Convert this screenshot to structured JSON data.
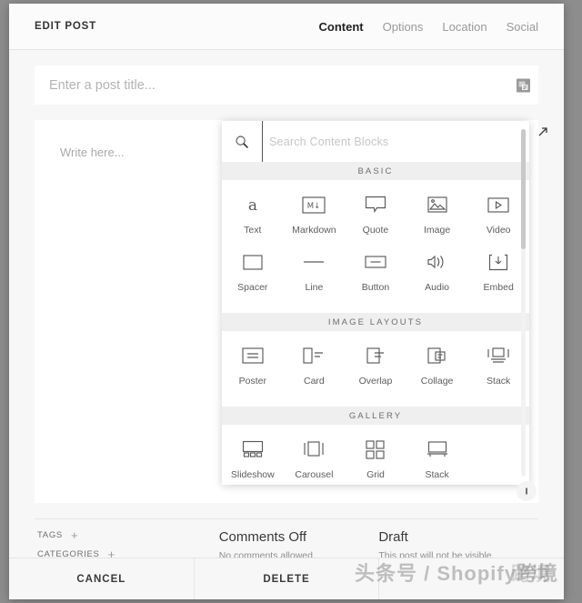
{
  "header": {
    "title": "EDIT POST",
    "tabs": [
      {
        "label": "Content",
        "active": true
      },
      {
        "label": "Options",
        "active": false
      },
      {
        "label": "Location",
        "active": false
      },
      {
        "label": "Social",
        "active": false
      }
    ]
  },
  "title_input": {
    "placeholder": "Enter a post title...",
    "value": "",
    "icon": "ime-keyboard-icon"
  },
  "editor": {
    "placeholder": "Write here...",
    "expand_icon": "expand-arrow-icon",
    "resize_icon": "resize-handle-icon"
  },
  "picker": {
    "search": {
      "placeholder": "Search Content Blocks",
      "value": "",
      "icon": "search-icon"
    },
    "sections": [
      {
        "name": "BASIC",
        "items": [
          {
            "label": "Text",
            "icon": "letter-a-icon"
          },
          {
            "label": "Markdown",
            "icon": "markdown-icon"
          },
          {
            "label": "Quote",
            "icon": "quote-bubble-icon"
          },
          {
            "label": "Image",
            "icon": "image-icon"
          },
          {
            "label": "Video",
            "icon": "video-play-icon"
          },
          {
            "label": "Spacer",
            "icon": "spacer-box-icon"
          },
          {
            "label": "Line",
            "icon": "horizontal-line-icon"
          },
          {
            "label": "Button",
            "icon": "button-icon"
          },
          {
            "label": "Audio",
            "icon": "audio-speaker-icon"
          },
          {
            "label": "Embed",
            "icon": "embed-download-icon"
          }
        ]
      },
      {
        "name": "IMAGE LAYOUTS",
        "items": [
          {
            "label": "Poster",
            "icon": "poster-icon"
          },
          {
            "label": "Card",
            "icon": "card-icon"
          },
          {
            "label": "Overlap",
            "icon": "overlap-icon"
          },
          {
            "label": "Collage",
            "icon": "collage-icon"
          },
          {
            "label": "Stack",
            "icon": "stack-layout-icon"
          }
        ]
      },
      {
        "name": "GALLERY",
        "items": [
          {
            "label": "Slideshow",
            "icon": "slideshow-icon"
          },
          {
            "label": "Carousel",
            "icon": "carousel-icon"
          },
          {
            "label": "Grid",
            "icon": "grid-icon"
          },
          {
            "label": "Stack",
            "icon": "stack-gallery-icon"
          }
        ]
      }
    ]
  },
  "meta": {
    "tags_label": "TAGS",
    "tags_add": "+",
    "categories_label": "CATEGORIES",
    "categories_add": "+",
    "comments": {
      "title": "Comments Off",
      "subtitle": "No comments allowed."
    },
    "status": {
      "title": "Draft",
      "subtitle": "This post will not be visible."
    }
  },
  "footer": {
    "buttons": [
      {
        "label": "CANCEL"
      },
      {
        "label": "DELETE"
      },
      {
        "label": ""
      }
    ]
  },
  "watermark": {
    "text": "头条号 / Shopify跨境",
    "overlay": "跨境"
  },
  "colors": {
    "page_background": "#8d8d8d",
    "modal_background": "#f7f7f7",
    "panel_white": "#ffffff",
    "section_band": "#efefef",
    "text_dark": "#333333",
    "text_muted": "#9a9a9a",
    "placeholder": "#b3b3b3",
    "icon_stroke": "#5a5a5a"
  }
}
